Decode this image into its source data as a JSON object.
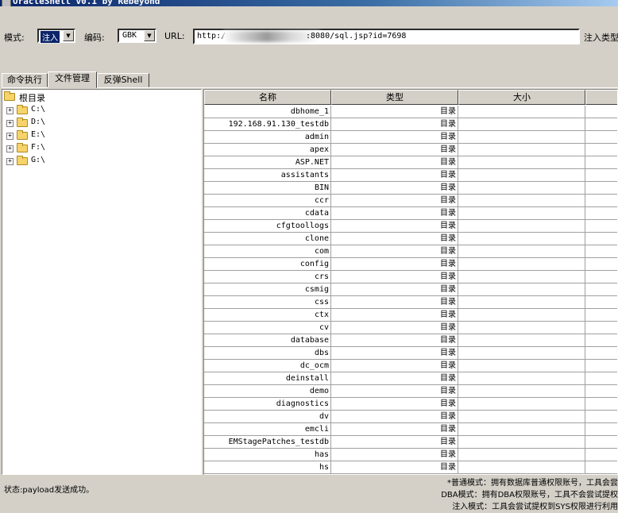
{
  "window": {
    "title": "OracleShell v0.1   by Rebeyond"
  },
  "toolbar": {
    "mode_label": "模式:",
    "mode_value": "注入",
    "encoding_label": "编码:",
    "encoding_value": "GBK",
    "url_label": "URL:",
    "url_prefix": "http:/",
    "url_suffix": ":8080/sql.jsp?id=7698",
    "inject_type_label": "注入类型"
  },
  "tabs": [
    {
      "label": "命令执行"
    },
    {
      "label": "文件管理"
    },
    {
      "label": "反弹Shell"
    }
  ],
  "tree": {
    "root": "根目录",
    "drives": [
      "C:\\",
      "D:\\",
      "E:\\",
      "F:\\",
      "G:\\"
    ]
  },
  "table": {
    "columns": [
      "名称",
      "类型",
      "大小"
    ],
    "rows": [
      [
        "dbhome_1",
        "目录",
        ""
      ],
      [
        "192.168.91.130_testdb",
        "目录",
        ""
      ],
      [
        "admin",
        "目录",
        ""
      ],
      [
        "apex",
        "目录",
        ""
      ],
      [
        "ASP.NET",
        "目录",
        ""
      ],
      [
        "assistants",
        "目录",
        ""
      ],
      [
        "BIN",
        "目录",
        ""
      ],
      [
        "ccr",
        "目录",
        ""
      ],
      [
        "cdata",
        "目录",
        ""
      ],
      [
        "cfgtoollogs",
        "目录",
        ""
      ],
      [
        "clone",
        "目录",
        ""
      ],
      [
        "com",
        "目录",
        ""
      ],
      [
        "config",
        "目录",
        ""
      ],
      [
        "crs",
        "目录",
        ""
      ],
      [
        "csmig",
        "目录",
        ""
      ],
      [
        "css",
        "目录",
        ""
      ],
      [
        "ctx",
        "目录",
        ""
      ],
      [
        "cv",
        "目录",
        ""
      ],
      [
        "database",
        "目录",
        ""
      ],
      [
        "dbs",
        "目录",
        ""
      ],
      [
        "dc_ocm",
        "目录",
        ""
      ],
      [
        "deinstall",
        "目录",
        ""
      ],
      [
        "demo",
        "目录",
        ""
      ],
      [
        "diagnostics",
        "目录",
        ""
      ],
      [
        "dv",
        "目录",
        ""
      ],
      [
        "emcli",
        "目录",
        ""
      ],
      [
        "EMStagePatches_testdb",
        "目录",
        ""
      ],
      [
        "has",
        "目录",
        ""
      ],
      [
        "hs",
        "目录",
        ""
      ]
    ]
  },
  "status": {
    "text": "状态:payload发送成功。"
  },
  "notes": [
    "*普通模式：拥有数据库普通权限账号，工具会尝",
    "DBA模式：拥有DBA权限账号，工具不会尝试提权",
    "注入模式：工具会尝试提权到SYS权限进行利用"
  ]
}
